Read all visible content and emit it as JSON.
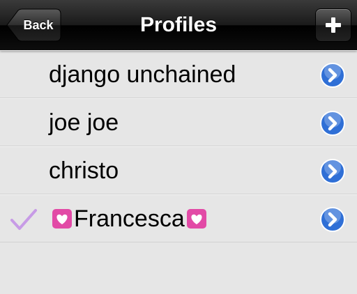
{
  "navbar": {
    "title": "Profiles",
    "back_label": "Back",
    "add_icon": "plus-icon"
  },
  "profiles": [
    {
      "name": "django unchained",
      "selected": false,
      "accessory": "disclosure-chevron-icon"
    },
    {
      "name": "joe joe",
      "selected": false,
      "accessory": "disclosure-chevron-icon"
    },
    {
      "name": "christo",
      "selected": false,
      "accessory": "disclosure-chevron-icon"
    },
    {
      "name": "Francesca",
      "selected": true,
      "decoration": "heart-emoji",
      "accessory": "disclosure-chevron-icon"
    }
  ],
  "colors": {
    "checkmark": "#c79be6",
    "chevron_blue": "#2f6fd6",
    "heart_pink": "#e24aa6"
  }
}
